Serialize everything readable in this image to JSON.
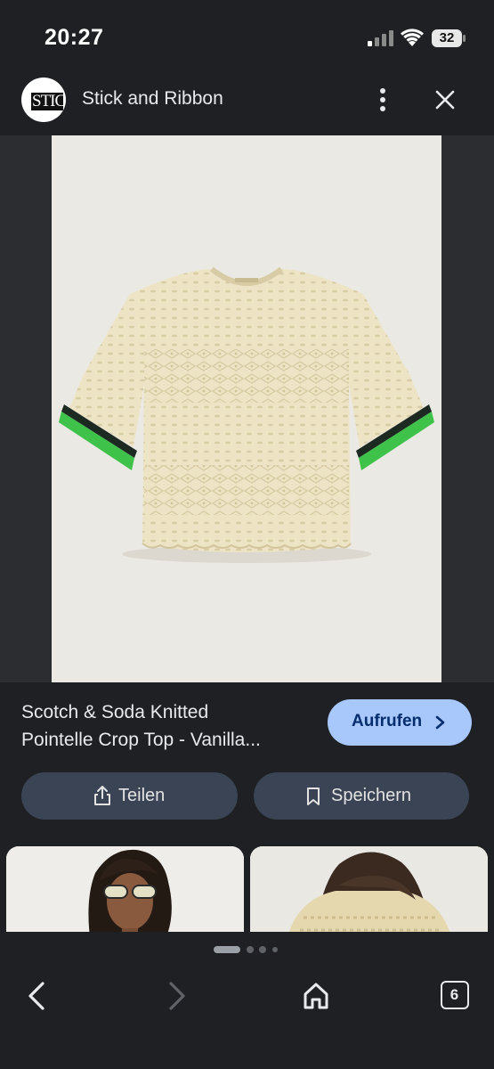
{
  "status": {
    "time": "20:27",
    "battery": "32"
  },
  "header": {
    "logo_text": "STIC",
    "site_name": "Stick and Ribbon",
    "more_icon": "more-vert-icon",
    "close_icon": "close-icon"
  },
  "product": {
    "title_line1": "Scotch & Soda Knitted",
    "title_line2": "Pointelle Crop Top - Vanilla...",
    "visit_label": "Aufrufen",
    "share_label": "Teilen",
    "save_label": "Speichern"
  },
  "colors": {
    "background": "#1f2023",
    "visit_button": "#a8c7fa",
    "pill_button": "#3a4455",
    "knit_cream": "#ece3c5",
    "sleeve_green": "#3ec24a"
  },
  "bottom_nav": {
    "back_icon": "chevron-left-icon",
    "forward_icon": "chevron-right-icon",
    "home_icon": "home-icon",
    "tab_count": "6",
    "carousel_page": 1,
    "carousel_pages": 4
  }
}
